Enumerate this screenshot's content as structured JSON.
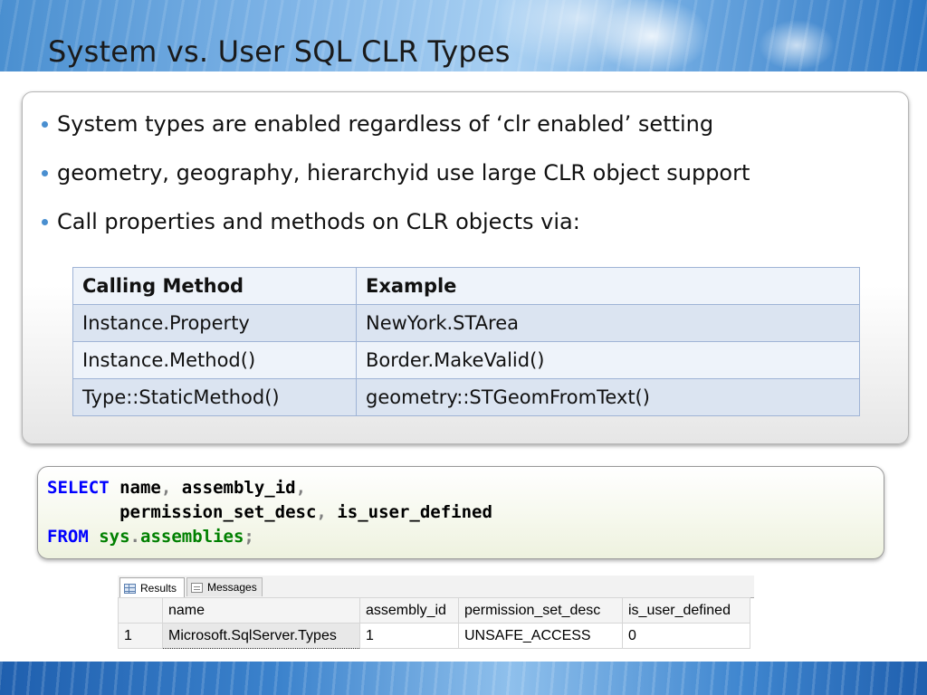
{
  "slide": {
    "title": "System vs. User SQL CLR Types",
    "bullets": [
      "System types are enabled regardless of ‘clr enabled’ setting",
      "geometry, geography, hierarchyid use large CLR object support",
      "Call properties and methods on CLR objects via:"
    ]
  },
  "methods_table": {
    "headers": [
      "Calling Method",
      "Example"
    ],
    "rows": [
      [
        "Instance.Property",
        "NewYork.STArea"
      ],
      [
        "Instance.Method()",
        "Border.MakeValid()"
      ],
      [
        "Type::StaticMethod()",
        "geometry::STGeomFromText()"
      ]
    ]
  },
  "code": {
    "select_kw": "SELECT",
    "col1": "name",
    "col2": "assembly_id",
    "col3": "permission_set_desc",
    "col4": "is_user_defined",
    "from_kw": "FROM",
    "schema": "sys",
    "object": "assemblies",
    "comma": ",",
    "dot": ".",
    "semicolon": ";"
  },
  "results": {
    "tabs": {
      "results": "Results",
      "messages": "Messages"
    },
    "icons": {
      "results": "grid-icon",
      "messages": "messages-icon"
    },
    "headers": [
      "name",
      "assembly_id",
      "permission_set_desc",
      "is_user_defined"
    ],
    "row": {
      "num": "1",
      "name": "Microsoft.SqlServer.Types",
      "assembly_id": "1",
      "permission_set_desc": "UNSAFE_ACCESS",
      "is_user_defined": "0"
    }
  },
  "colors": {
    "keyword": "#0000ff",
    "object": "#008000",
    "punctuation": "#808080",
    "bullet": "#4a8fd0"
  }
}
